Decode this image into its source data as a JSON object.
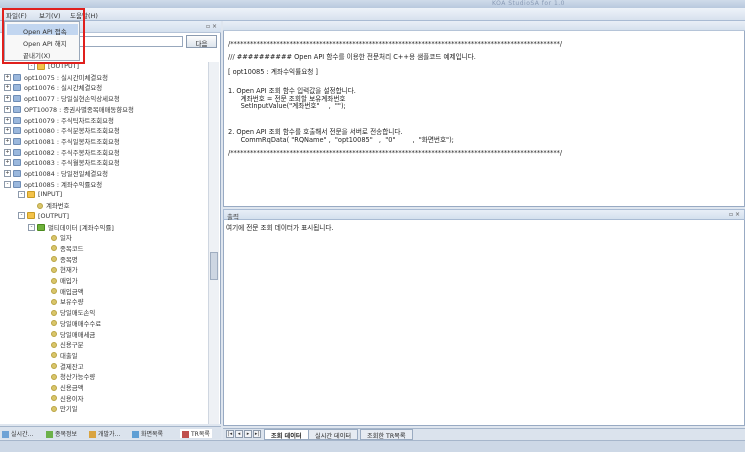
{
  "window": {
    "title": "KOA StudioSA for 1.0"
  },
  "menubar": {
    "items": [
      "파일(F)",
      "보기(V)",
      "도움말(H)"
    ]
  },
  "file_menu": {
    "items": [
      "Open API 접속",
      "Open API 해지",
      "끝내기(X)"
    ],
    "active_index": 0
  },
  "left_panel": {
    "search_button": "다음",
    "tree": [
      {
        "depth": 2,
        "icon": "folder",
        "expander": "-",
        "label": "[OUTPUT]"
      },
      {
        "depth": 0,
        "icon": "doc",
        "expander": "+",
        "label": "opt10075 : 실시간미체결요청"
      },
      {
        "depth": 0,
        "icon": "doc",
        "expander": "+",
        "label": "opt10076 : 실시간체결요청"
      },
      {
        "depth": 0,
        "icon": "doc",
        "expander": "+",
        "label": "opt10077 : 당일실현손익상세요청"
      },
      {
        "depth": 0,
        "icon": "doc",
        "expander": "+",
        "label": "OPT10078 : 증권사별종목매매동향요청"
      },
      {
        "depth": 0,
        "icon": "doc",
        "expander": "+",
        "label": "opt10079 : 주식틱차트조회요청"
      },
      {
        "depth": 0,
        "icon": "doc",
        "expander": "+",
        "label": "opt10080 : 주식분봉차트조회요청"
      },
      {
        "depth": 0,
        "icon": "doc",
        "expander": "+",
        "label": "opt10081 : 주식일봉차트조회요청"
      },
      {
        "depth": 0,
        "icon": "doc",
        "expander": "+",
        "label": "opt10082 : 주식주봉차트조회요청"
      },
      {
        "depth": 0,
        "icon": "doc",
        "expander": "+",
        "label": "opt10083 : 주식월봉차트조회요청"
      },
      {
        "depth": 0,
        "icon": "doc",
        "expander": "+",
        "label": "opt10084 : 당일전일체결요청"
      },
      {
        "depth": 0,
        "icon": "doc",
        "expander": "-",
        "label": "opt10085 : 계좌수익률요청"
      },
      {
        "depth": 1,
        "icon": "folder",
        "expander": "-",
        "label": "[INPUT]"
      },
      {
        "depth": 2,
        "icon": "item",
        "expander": "",
        "label": "계좌번호"
      },
      {
        "depth": 1,
        "icon": "folder",
        "expander": "-",
        "label": "[OUTPUT]"
      },
      {
        "depth": 2,
        "icon": "multi",
        "expander": "-",
        "label": "멀티데이터 [계좌수익률]"
      },
      {
        "depth": 3,
        "icon": "item",
        "expander": "",
        "label": "일자"
      },
      {
        "depth": 3,
        "icon": "item",
        "expander": "",
        "label": "종목코드"
      },
      {
        "depth": 3,
        "icon": "item",
        "expander": "",
        "label": "종목명"
      },
      {
        "depth": 3,
        "icon": "item",
        "expander": "",
        "label": "현재가"
      },
      {
        "depth": 3,
        "icon": "item",
        "expander": "",
        "label": "매입가"
      },
      {
        "depth": 3,
        "icon": "item",
        "expander": "",
        "label": "매입금액"
      },
      {
        "depth": 3,
        "icon": "item",
        "expander": "",
        "label": "보유수량"
      },
      {
        "depth": 3,
        "icon": "item",
        "expander": "",
        "label": "당일매도손익"
      },
      {
        "depth": 3,
        "icon": "item",
        "expander": "",
        "label": "당일매매수수료"
      },
      {
        "depth": 3,
        "icon": "item",
        "expander": "",
        "label": "당일매매세금"
      },
      {
        "depth": 3,
        "icon": "item",
        "expander": "",
        "label": "신용구분"
      },
      {
        "depth": 3,
        "icon": "item",
        "expander": "",
        "label": "대출일"
      },
      {
        "depth": 3,
        "icon": "item",
        "expander": "",
        "label": "결제잔고"
      },
      {
        "depth": 3,
        "icon": "item",
        "expander": "",
        "label": "청산가능수량"
      },
      {
        "depth": 3,
        "icon": "item",
        "expander": "",
        "label": "신용금액"
      },
      {
        "depth": 3,
        "icon": "item",
        "expander": "",
        "label": "신용이자"
      },
      {
        "depth": 3,
        "icon": "item",
        "expander": "",
        "label": "만기일"
      }
    ],
    "tabs": [
      "실시간...",
      "종목정보",
      "개발가...",
      "화면목록",
      "TR목록"
    ]
  },
  "code_panel": {
    "lines": [
      "/****************************************************************************************************/",
      "/// ########## Open API 함수를 이용한 전문처리 C++용 샘플코드 예제입니다.",
      "",
      "[ opt10085 : 계좌수익률요청 ]",
      "",
      "1. Open API 조회 함수 입력값을 설정합니다.",
      "      계좌번호 = 전문 조회할 보유계좌번호",
      "      SetInputValue(\"계좌번호\"\t,  \"\");",
      "",
      "",
      "2. Open API 조회 함수를 호출해서 전문을 서버로 전송합니다.",
      "      CommRqData( \"RQName\"\t,  \"opt10085\"\t,  \"0\"\t,  \"화면번호\");",
      "",
      "/****************************************************************************************************/"
    ]
  },
  "output_panel": {
    "title": "출력",
    "message": "여기에 전문 조회 데이터가 표시됩니다."
  },
  "bottom_tabs": [
    "조회 데이터",
    "실시간 데이터",
    "조회한 TR목록"
  ],
  "colors": {
    "highlight_box": "#e0201d",
    "selection": "#c2d6f0"
  }
}
